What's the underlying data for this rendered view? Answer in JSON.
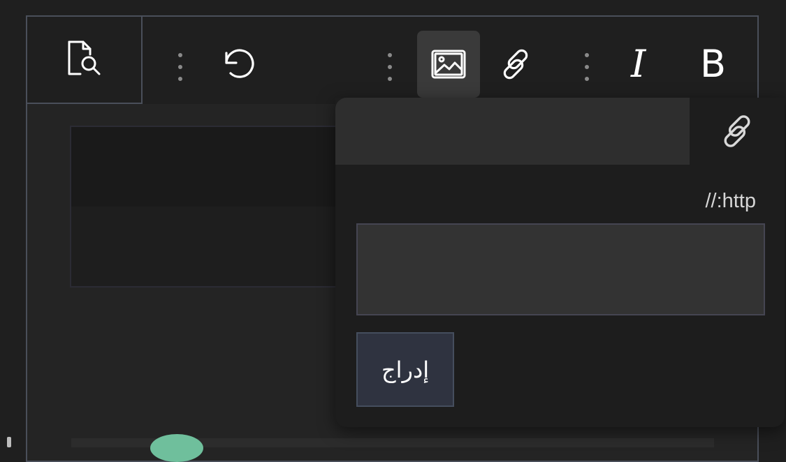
{
  "toolbar": {
    "items": [
      {
        "name": "preview",
        "icon": "document-search-icon"
      },
      {
        "name": "separator-1",
        "icon": "kebab-menu-icon"
      },
      {
        "name": "undo",
        "icon": "undo-icon"
      },
      {
        "name": "separator-2",
        "icon": "kebab-menu-icon"
      },
      {
        "name": "image",
        "icon": "image-icon",
        "active": true
      },
      {
        "name": "link",
        "icon": "link-icon"
      },
      {
        "name": "separator-3",
        "icon": "kebab-menu-icon"
      },
      {
        "name": "italic",
        "label": "I"
      },
      {
        "name": "bold",
        "label": "B"
      }
    ],
    "italic_label": "I",
    "bold_label": "B"
  },
  "popup": {
    "tab_icon": "link-icon",
    "url_label": "http://",
    "url_value": "",
    "url_placeholder": "",
    "insert_label": "إدراج"
  },
  "colors": {
    "background": "#1f1f1f",
    "frame_border": "#4a4f5a",
    "active_tool_bg": "#3a3a3a",
    "popup_bg": "#1d1d1d",
    "popup_header_bg": "#2e2e2e",
    "input_bg": "#333333",
    "button_bg": "#2f3340",
    "avatar": "#6fbf9c"
  }
}
